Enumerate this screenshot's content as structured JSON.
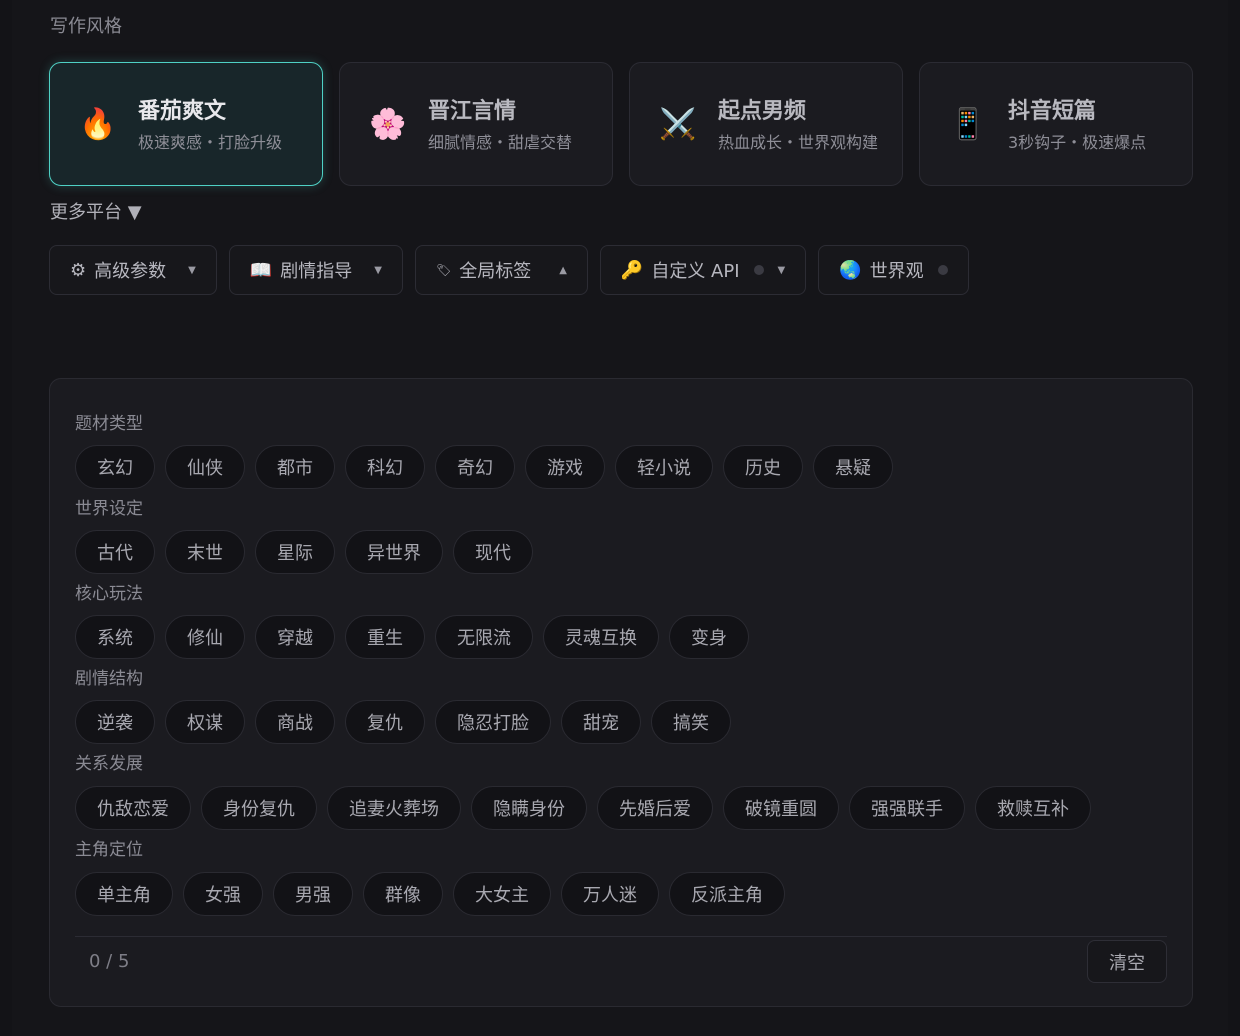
{
  "section_title": "写作风格",
  "styles": [
    {
      "icon": "🔥",
      "icon_name": "fire-icon",
      "name": "番茄爽文",
      "desc": "极速爽感・打脸升级",
      "active": true
    },
    {
      "icon": "🌸",
      "icon_name": "cherry-blossom-icon",
      "name": "晋江言情",
      "desc": "细腻情感・甜虐交替",
      "active": false
    },
    {
      "icon": "⚔️",
      "icon_name": "crossed-swords-icon",
      "name": "起点男频",
      "desc": "热血成长・世界观构建",
      "active": false
    },
    {
      "icon": "📱",
      "icon_name": "mobile-phone-icon",
      "name": "抖音短篇",
      "desc": "3秒钩子・极速爆点",
      "active": false
    }
  ],
  "more_platforms": "更多平台 ▼",
  "toolbar": {
    "advanced": {
      "icon": "⚙",
      "label": "高级参数"
    },
    "plot": {
      "icon": "📖",
      "label": "剧情指导"
    },
    "tags": {
      "icon": "🏷",
      "label": "全局标签"
    },
    "api": {
      "icon": "🔑",
      "label": "自定义 API"
    },
    "world": {
      "icon": "🌏",
      "label": "世界观"
    }
  },
  "tag_groups": [
    {
      "label": "题材类型",
      "tags": [
        "玄幻",
        "仙侠",
        "都市",
        "科幻",
        "奇幻",
        "游戏",
        "轻小说",
        "历史",
        "悬疑"
      ]
    },
    {
      "label": "世界设定",
      "tags": [
        "古代",
        "末世",
        "星际",
        "异世界",
        "现代"
      ]
    },
    {
      "label": "核心玩法",
      "tags": [
        "系统",
        "修仙",
        "穿越",
        "重生",
        "无限流",
        "灵魂互换",
        "变身"
      ]
    },
    {
      "label": "剧情结构",
      "tags": [
        "逆袭",
        "权谋",
        "商战",
        "复仇",
        "隐忍打脸",
        "甜宠",
        "搞笑"
      ]
    },
    {
      "label": "关系发展",
      "tags": [
        "仇敌恋爱",
        "身份复仇",
        "追妻火葬场",
        "隐瞒身份",
        "先婚后爱",
        "破镜重圆",
        "强强联手",
        "救赎互补"
      ]
    },
    {
      "label": "主角定位",
      "tags": [
        "单主角",
        "女强",
        "男强",
        "群像",
        "大女主",
        "万人迷",
        "反派主角"
      ]
    }
  ],
  "counter": "0 / 5",
  "clear_label": "清空",
  "accent_color": "#4fd1c5"
}
